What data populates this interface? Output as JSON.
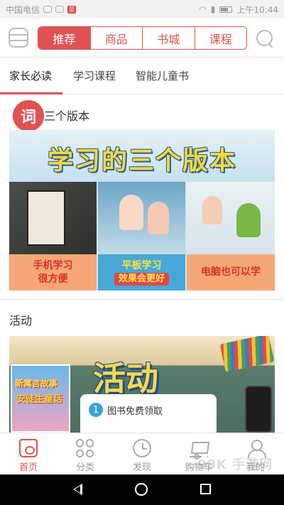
{
  "status_bar": {
    "carrier": "中国电信",
    "badge": "菜",
    "time": "上午10:44"
  },
  "top_nav": {
    "segments": [
      {
        "label": "推荐",
        "active": true
      },
      {
        "label": "商品",
        "active": false
      },
      {
        "label": "书城",
        "active": false
      },
      {
        "label": "课程",
        "active": false
      }
    ],
    "accent_color": "#e05252"
  },
  "sub_tabs": [
    {
      "label": "家长必读",
      "active": true
    },
    {
      "label": "学习课程",
      "active": false
    },
    {
      "label": "智能儿童书",
      "active": false
    }
  ],
  "section_versions": {
    "title": "三个版本",
    "float_badge": "词",
    "banner_title": "学习的三个版本",
    "captions": [
      {
        "line1": "手机学习",
        "line2": "很方便"
      },
      {
        "line1": "平板学习",
        "line2": "效果会更好"
      },
      {
        "line1": "电脑也可以学",
        "line2": ""
      }
    ]
  },
  "section_activity": {
    "title": "活动",
    "banner_title": "活动",
    "book_cover_text_1": "新寓言故事",
    "book_cover_text_2": "安徒生童话",
    "list_item_number": "1",
    "list_item_text": "图书免费领取"
  },
  "tab_bar": [
    {
      "label": "首页",
      "icon": "home-icon",
      "active": true
    },
    {
      "label": "分类",
      "icon": "category-icon",
      "active": false
    },
    {
      "label": "发现",
      "icon": "discover-icon",
      "active": false
    },
    {
      "label": "购物车",
      "icon": "cart-icon",
      "active": false
    },
    {
      "label": "我的",
      "icon": "user-icon",
      "active": false
    }
  ],
  "watermark": "99K 手游网"
}
